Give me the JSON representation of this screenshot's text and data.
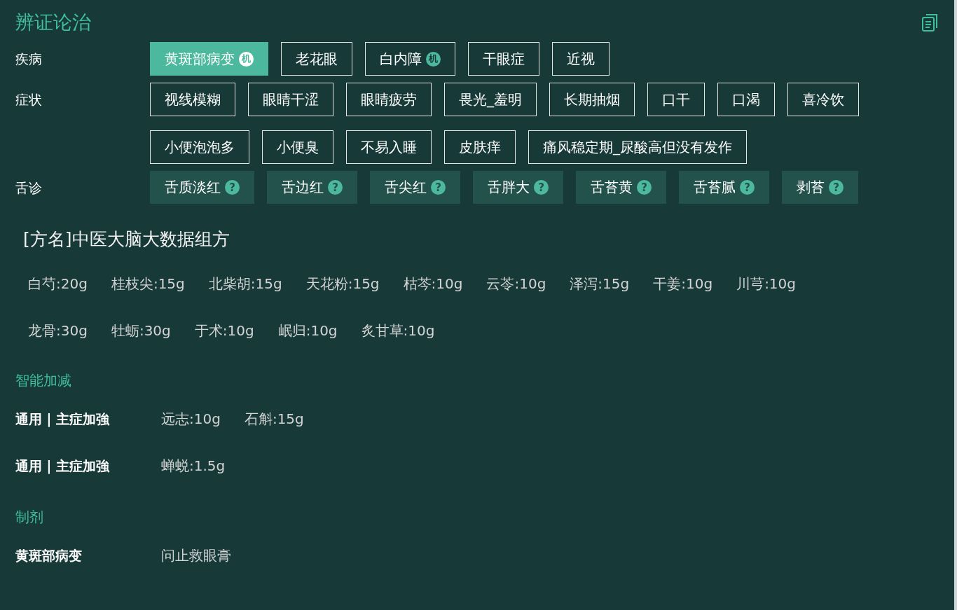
{
  "title": "辨证论治",
  "groups": [
    {
      "label": "疾病",
      "kind": "outline",
      "tags": [
        {
          "text": "黄斑部病变",
          "selected": true,
          "badge": "机"
        },
        {
          "text": "老花眼",
          "selected": false
        },
        {
          "text": "白内障",
          "selected": false,
          "badge": "机"
        },
        {
          "text": "干眼症",
          "selected": false
        },
        {
          "text": "近视",
          "selected": false
        }
      ]
    },
    {
      "label": "症状",
      "kind": "outline",
      "tags": [
        {
          "text": "视线模糊",
          "selected": false
        },
        {
          "text": "眼睛干涩",
          "selected": false
        },
        {
          "text": "眼睛疲劳",
          "selected": false
        },
        {
          "text": "畏光_羞明",
          "selected": false
        },
        {
          "text": "长期抽烟",
          "selected": false
        },
        {
          "text": "口干",
          "selected": false
        },
        {
          "text": "口渴",
          "selected": false
        },
        {
          "text": "喜冷饮",
          "selected": false
        },
        {
          "text": "小便泡泡多",
          "selected": false
        },
        {
          "text": "小便臭",
          "selected": false
        },
        {
          "text": "不易入睡",
          "selected": false
        },
        {
          "text": "皮肤痒",
          "selected": false
        },
        {
          "text": "痛风稳定期_尿酸高但没有发作",
          "selected": false
        }
      ]
    },
    {
      "label": "舌诊",
      "kind": "filled",
      "tags": [
        {
          "text": "舌质淡红",
          "selected": false,
          "hint": "?"
        },
        {
          "text": "舌边红",
          "selected": false,
          "hint": "?"
        },
        {
          "text": "舌尖红",
          "selected": false,
          "hint": "?"
        },
        {
          "text": "舌胖大",
          "selected": false,
          "hint": "?"
        },
        {
          "text": "舌苔黄",
          "selected": false,
          "hint": "?"
        },
        {
          "text": "舌苔腻",
          "selected": false,
          "hint": "?"
        },
        {
          "text": "剥苔",
          "selected": false,
          "hint": "?"
        }
      ]
    }
  ],
  "prescription": {
    "name": "[方名]中医大脑大数据组方",
    "herbs": [
      "白芍:20g",
      "桂枝尖:15g",
      "北柴胡:15g",
      "天花粉:15g",
      "枯芩:10g",
      "云苓:10g",
      "泽泻:15g",
      "干姜:10g",
      "川芎:10g",
      "龙骨:30g",
      "牡蛎:30g",
      "于术:10g",
      "岷归:10g",
      "炙甘草:10g"
    ]
  },
  "sections": [
    {
      "heading": "智能加减",
      "rows": [
        {
          "label": "通用 | 主症加強",
          "items": [
            "远志:10g",
            "石斛:15g"
          ]
        },
        {
          "label": "通用 | 主症加強",
          "items": [
            "蝉蜕:1.5g"
          ]
        }
      ]
    },
    {
      "heading": "制剂",
      "rows": [
        {
          "label": "黄斑部病变",
          "items": [
            "问止救眼膏"
          ]
        }
      ]
    }
  ]
}
